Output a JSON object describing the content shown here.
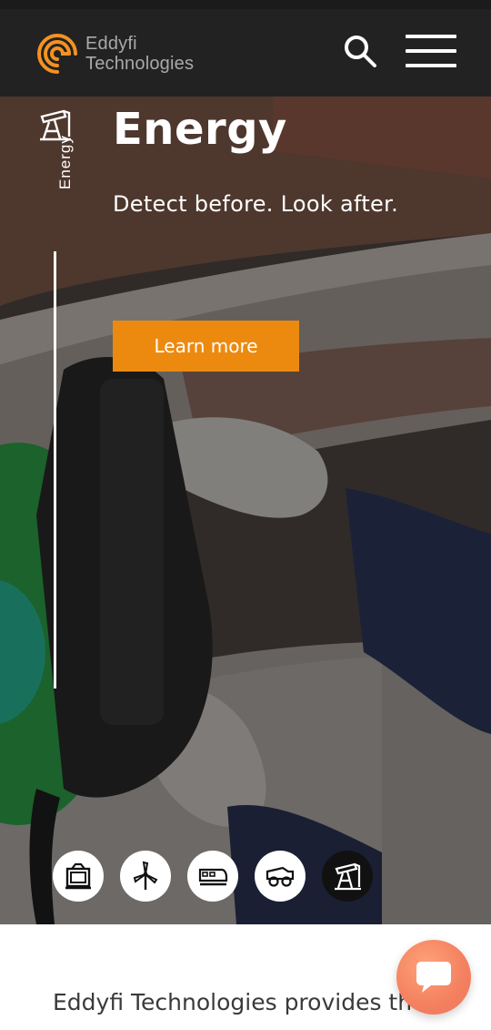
{
  "header": {
    "brand_line1": "Eddyfi",
    "brand_line2": "Technologies",
    "icons": {
      "logo": "eddyfi-logo-icon",
      "search": "search-icon",
      "menu": "hamburger-menu-icon"
    },
    "colors": {
      "background": "#222222",
      "brand_orange": "#f39221",
      "brand_text": "#a9a9a9"
    }
  },
  "hero": {
    "section_label": "Energy",
    "section_icon": "oil-pump-icon",
    "title": "Energy",
    "tagline": "Detect before. Look after.",
    "cta_label": "Learn more",
    "colors": {
      "cta": "#ec8a10",
      "text": "#ffffff"
    }
  },
  "categories": [
    {
      "icon": "frame-structure-icon",
      "active": false
    },
    {
      "icon": "wind-turbine-icon",
      "active": false
    },
    {
      "icon": "train-icon",
      "active": false
    },
    {
      "icon": "mining-truck-icon",
      "active": false
    },
    {
      "icon": "oil-pump-icon",
      "active": true
    }
  ],
  "content": {
    "intro_text": "Eddyfi Technologies provides the"
  },
  "chat": {
    "icon": "chat-bubble-icon",
    "color": "#f3805f"
  }
}
